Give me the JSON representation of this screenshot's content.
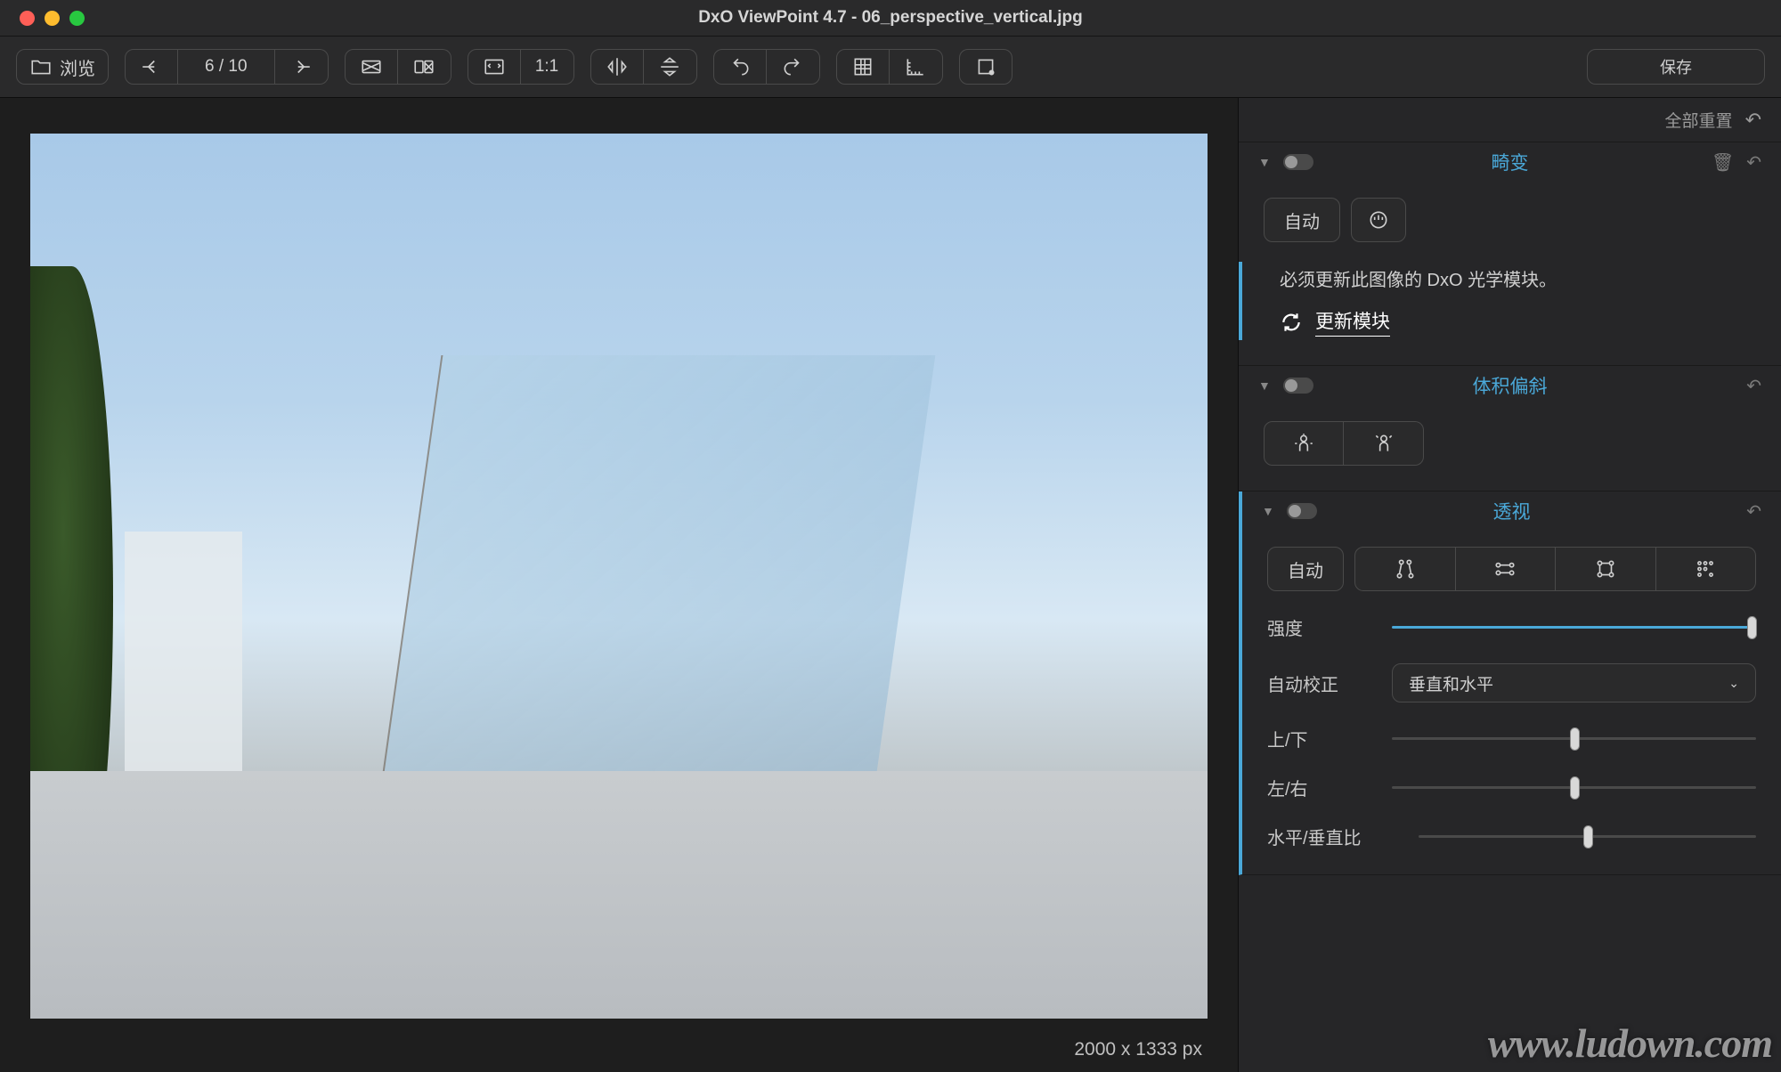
{
  "window": {
    "title": "DxO ViewPoint 4.7 - 06_perspective_vertical.jpg"
  },
  "toolbar": {
    "browse": "浏览",
    "counter": "6 / 10",
    "zoom_fit": "1:1",
    "save": "保存"
  },
  "viewer": {
    "dimensions": "2000 x 1333 px"
  },
  "sidebar": {
    "reset_all": "全部重置",
    "panels": {
      "distortion": {
        "title": "畸变",
        "auto": "自动",
        "notice": "必须更新此图像的 DxO 光学模块。",
        "update": "更新模块"
      },
      "volume": {
        "title": "体积偏斜"
      },
      "perspective": {
        "title": "透视",
        "auto": "自动",
        "intensity": "强度",
        "auto_correct": "自动校正",
        "auto_correct_value": "垂直和水平",
        "up_down": "上/下",
        "left_right": "左/右",
        "hv_ratio": "水平/垂直比"
      }
    }
  },
  "watermark": "www.ludown.com"
}
